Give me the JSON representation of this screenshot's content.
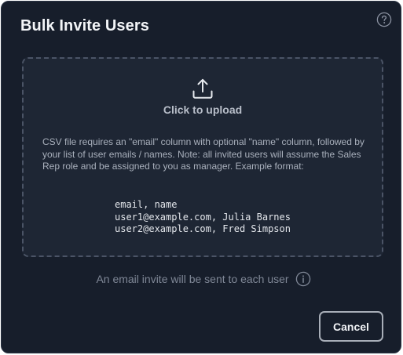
{
  "dialog": {
    "title": "Bulk Invite Users",
    "help_icon": "help-circle-icon"
  },
  "dropzone": {
    "icon": "upload-icon",
    "label": "Click to upload",
    "description": "CSV file requires an \"email\" column with optional \"name\" column, followed by your list of user emails / names. Note: all invited users will assume the Sales Rep role and be assigned to you as manager. Example format:",
    "example_lines": [
      "email, name",
      "user1@example.com, Julia Barnes",
      "user2@example.com, Fred Simpson"
    ]
  },
  "note": {
    "text": "An email invite will be sent to each user",
    "icon": "info-icon"
  },
  "footer": {
    "cancel_label": "Cancel"
  },
  "colors": {
    "dialog_background": "#171e2b",
    "dropzone_background": "#1e2634",
    "dropzone_border": "#4b5466",
    "muted_text": "#7f8796"
  }
}
